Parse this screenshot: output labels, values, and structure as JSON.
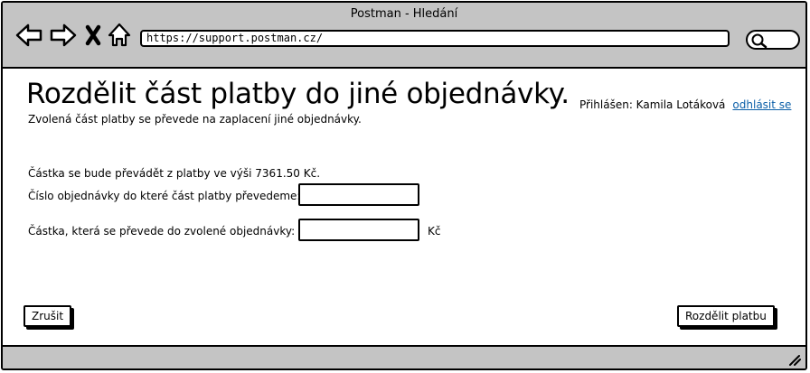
{
  "window": {
    "title": "Postman - Hledání"
  },
  "browser": {
    "url": "https://support.postman.cz/",
    "icons": [
      "back-arrow-icon",
      "forward-arrow-icon",
      "close-icon",
      "home-icon",
      "search-icon"
    ]
  },
  "header": {
    "title": "Rozdělit část platby do jiné objednávky.",
    "subtitle": "Zvolená část platby se převede na zaplacení jiné objednávky.",
    "login_label": "Přihlášen: Kamila Lotáková",
    "logout_label": "odhlásit se"
  },
  "form": {
    "info_text": "Částka se bude převádět z platby ve výši 7361.50 Kč.",
    "order_label": "Číslo objednávky do které část platby převedeme:",
    "order_value": "",
    "amount_label": "Částka, která se převede do zvolené objednávky:",
    "amount_value": "",
    "currency": "Kč"
  },
  "actions": {
    "cancel_label": "Zrušit",
    "split_label": "Rozdělit platbu"
  },
  "colors": {
    "chrome": "#c4c4c4",
    "link": "#0b5fa8"
  }
}
